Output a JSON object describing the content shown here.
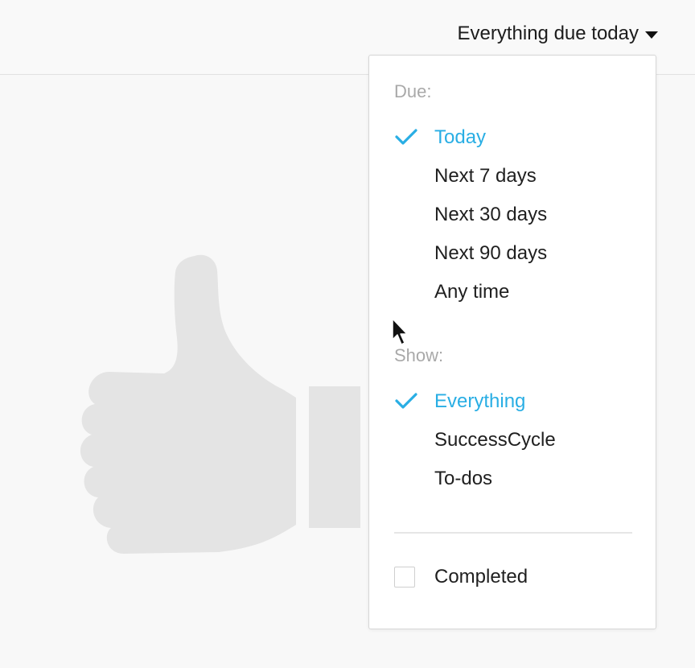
{
  "header": {
    "filter_label": "Everything due today",
    "caret_icon": "caret-down-icon"
  },
  "dropdown": {
    "due_section": {
      "label": "Due:",
      "options": [
        {
          "label": "Today",
          "selected": true
        },
        {
          "label": "Next 7 days",
          "selected": false
        },
        {
          "label": "Next 30 days",
          "selected": false
        },
        {
          "label": "Next 90 days",
          "selected": false
        },
        {
          "label": "Any time",
          "selected": false
        }
      ]
    },
    "show_section": {
      "label": "Show:",
      "options": [
        {
          "label": "Everything",
          "selected": true
        },
        {
          "label": "SuccessCycle",
          "selected": false
        },
        {
          "label": "To-dos",
          "selected": false
        }
      ]
    },
    "completed": {
      "label": "Completed",
      "checked": false
    }
  },
  "empty_state": {
    "icon": "thumbs-up-icon"
  },
  "colors": {
    "accent": "#29aee4",
    "thumb": "#e4e4e4",
    "section_label": "#a9a9a9"
  }
}
